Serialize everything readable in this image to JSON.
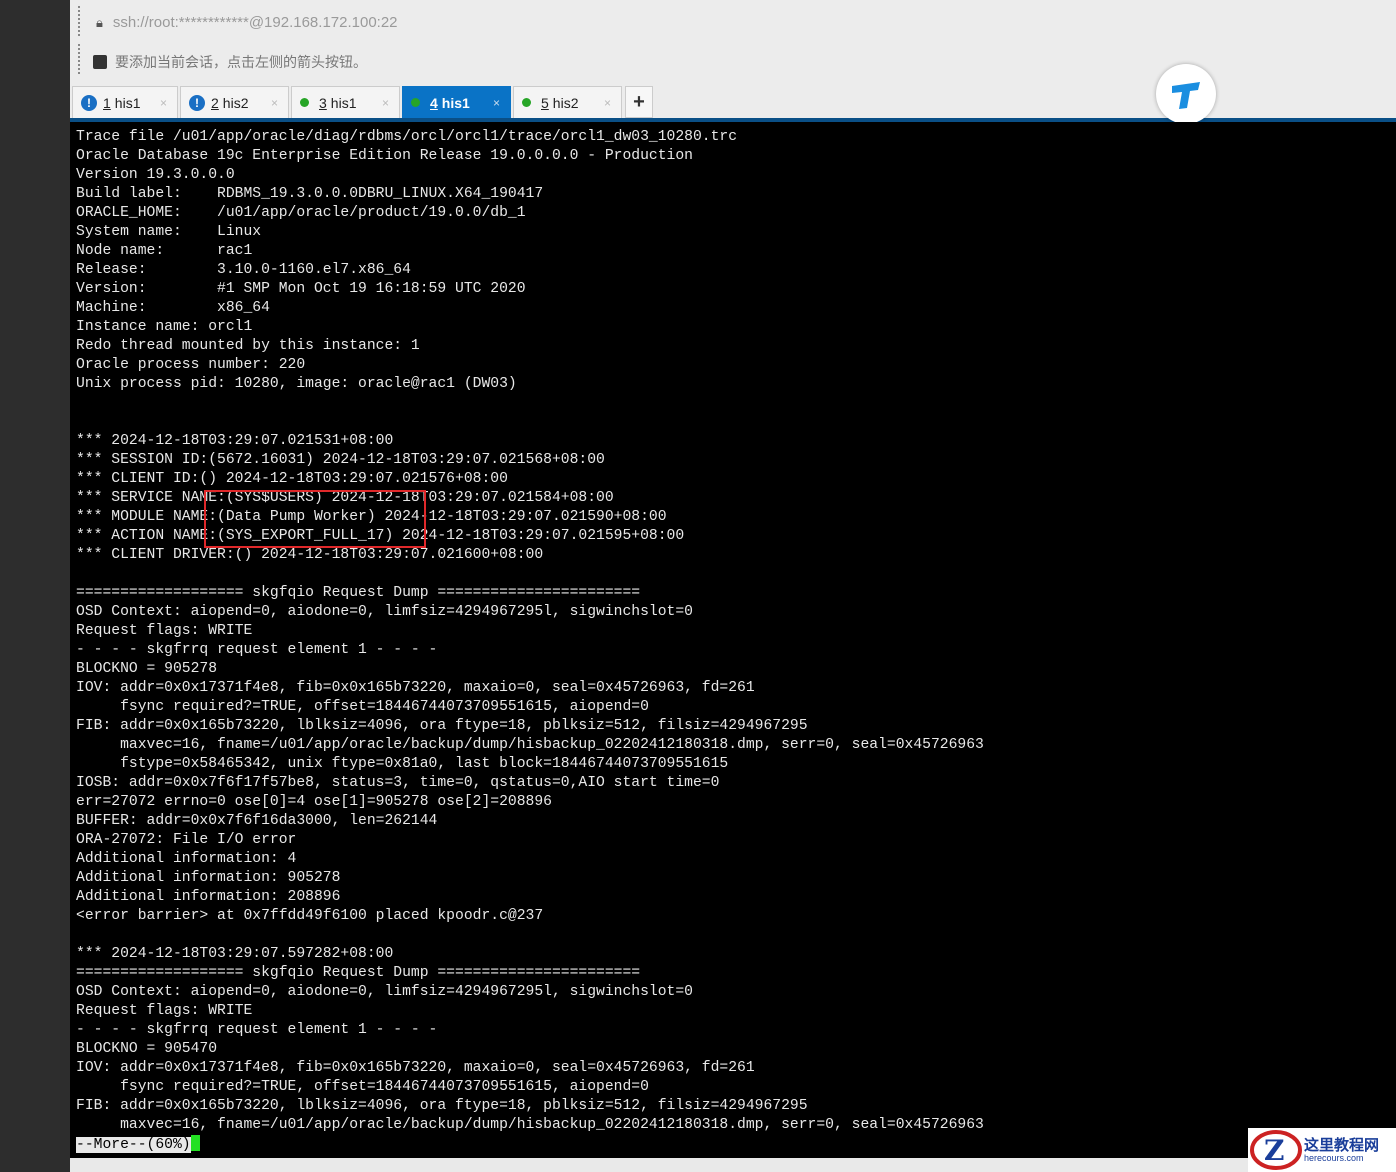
{
  "address_bar": {
    "url": "ssh://root:************@192.168.172.100:22"
  },
  "hint": {
    "text": "要添加当前会话，点击左侧的箭头按钮。"
  },
  "tabs": [
    {
      "num": "1",
      "label": "his1",
      "status": "warning"
    },
    {
      "num": "2",
      "label": "his2",
      "status": "warning"
    },
    {
      "num": "3",
      "label": "his1",
      "status": "connected"
    },
    {
      "num": "4",
      "label": "his1",
      "status": "connected",
      "active": true
    },
    {
      "num": "5",
      "label": "his2",
      "status": "connected"
    }
  ],
  "tab_close": "×",
  "tab_add": "+",
  "terminal": {
    "lines": [
      "Trace file /u01/app/oracle/diag/rdbms/orcl/orcl1/trace/orcl1_dw03_10280.trc",
      "Oracle Database 19c Enterprise Edition Release 19.0.0.0.0 - Production",
      "Version 19.3.0.0.0",
      "Build label:    RDBMS_19.3.0.0.0DBRU_LINUX.X64_190417",
      "ORACLE_HOME:    /u01/app/oracle/product/19.0.0/db_1",
      "System name:    Linux",
      "Node name:      rac1",
      "Release:        3.10.0-1160.el7.x86_64",
      "Version:        #1 SMP Mon Oct 19 16:18:59 UTC 2020",
      "Machine:        x86_64",
      "Instance name: orcl1",
      "Redo thread mounted by this instance: 1",
      "Oracle process number: 220",
      "Unix process pid: 10280, image: oracle@rac1 (DW03)",
      "",
      "",
      "*** 2024-12-18T03:29:07.021531+08:00",
      "*** SESSION ID:(5672.16031) 2024-12-18T03:29:07.021568+08:00",
      "*** CLIENT ID:() 2024-12-18T03:29:07.021576+08:00",
      "*** SERVICE NAME:(SYS$USERS) 2024-12-18T03:29:07.021584+08:00",
      "*** MODULE NAME:(Data Pump Worker) 2024-12-18T03:29:07.021590+08:00",
      "*** ACTION NAME:(SYS_EXPORT_FULL_17) 2024-12-18T03:29:07.021595+08:00",
      "*** CLIENT DRIVER:() 2024-12-18T03:29:07.021600+08:00",
      "",
      "=================== skgfqio Request Dump =======================",
      "OSD Context: aiopend=0, aiodone=0, limfsiz=4294967295l, sigwinchslot=0",
      "Request flags: WRITE",
      "- - - - skgfrrq request element 1 - - - -",
      "BLOCKNO = 905278",
      "IOV: addr=0x0x17371f4e8, fib=0x0x165b73220, maxaio=0, seal=0x45726963, fd=261",
      "     fsync required?=TRUE, offset=18446744073709551615, aiopend=0",
      "FIB: addr=0x0x165b73220, lblksiz=4096, ora ftype=18, pblksiz=512, filsiz=4294967295",
      "     maxvec=16, fname=/u01/app/oracle/backup/dump/hisbackup_02202412180318.dmp, serr=0, seal=0x45726963",
      "     fstype=0x58465342, unix ftype=0x81a0, last block=18446744073709551615",
      "IOSB: addr=0x0x7f6f17f57be8, status=3, time=0, qstatus=0,AIO start time=0",
      "err=27072 errno=0 ose[0]=4 ose[1]=905278 ose[2]=208896",
      "BUFFER: addr=0x0x7f6f16da3000, len=262144",
      "ORA-27072: File I/O error",
      "Additional information: 4",
      "Additional information: 905278",
      "Additional information: 208896",
      "<error barrier> at 0x7ffdd49f6100 placed kpoodr.c@237",
      "",
      "*** 2024-12-18T03:29:07.597282+08:00",
      "=================== skgfqio Request Dump =======================",
      "OSD Context: aiopend=0, aiodone=0, limfsiz=4294967295l, sigwinchslot=0",
      "Request flags: WRITE",
      "- - - - skgfrrq request element 1 - - - -",
      "BLOCKNO = 905470",
      "IOV: addr=0x0x17371f4e8, fib=0x0x165b73220, maxaio=0, seal=0x45726963, fd=261",
      "     fsync required?=TRUE, offset=18446744073709551615, aiopend=0",
      "FIB: addr=0x0x165b73220, lblksiz=4096, ora ftype=18, pblksiz=512, filsiz=4294967295",
      "     maxvec=16, fname=/u01/app/oracle/backup/dump/hisbackup_02202412180318.dmp, serr=0, seal=0x45726963"
    ],
    "pager_prompt": "--More--(60%)"
  },
  "watermark": {
    "title": "这里教程网",
    "url": "herecours.com"
  },
  "colors": {
    "accent": "#0a73c6",
    "highlight_box": "#e0282a",
    "cursor": "#22e022"
  }
}
